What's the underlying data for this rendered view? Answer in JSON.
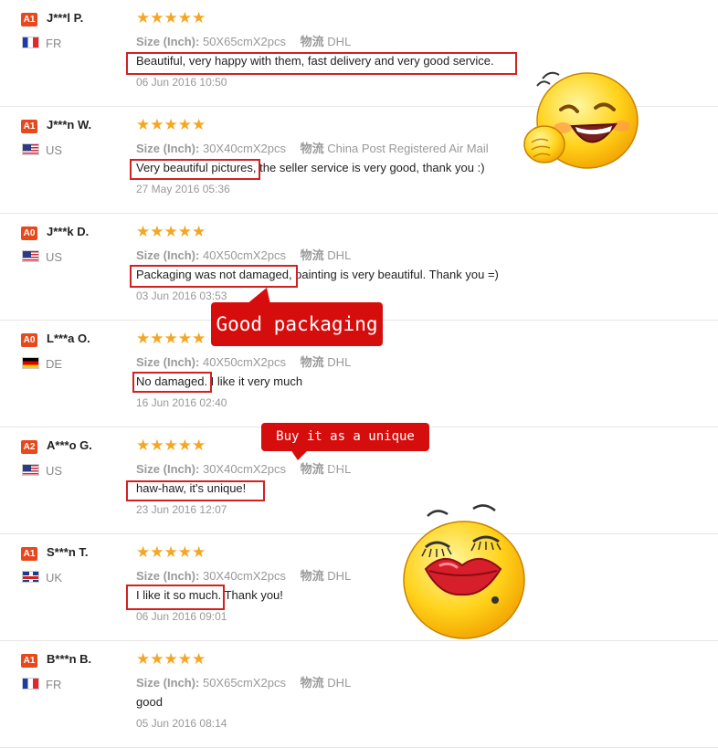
{
  "reviews": [
    {
      "badge": "A1",
      "name": "J***l P.",
      "flag": "fr",
      "country": "FR",
      "stars": "★★★★★",
      "size_label": "Size (Inch):",
      "size": "50X65cmX2pcs",
      "ship_label": "物流",
      "ship": "DHL",
      "comment": "Beautiful, very happy with them, fast delivery and very good service.",
      "date": "06 Jun 2016 10:50"
    },
    {
      "badge": "A1",
      "name": "J***n W.",
      "flag": "us",
      "country": "US",
      "stars": "★★★★★",
      "size_label": "Size (Inch):",
      "size": "30X40cmX2pcs",
      "ship_label": "物流",
      "ship": "China Post Registered Air Mail",
      "comment": "Very beautiful pictures, the seller service is very good, thank you :)",
      "date": "27 May 2016 05:36"
    },
    {
      "badge": "A0",
      "name": "J***k D.",
      "flag": "us",
      "country": "US",
      "stars": "★★★★★",
      "size_label": "Size (Inch):",
      "size": "40X50cmX2pcs",
      "ship_label": "物流",
      "ship": "DHL",
      "comment": "Packaging was not damaged, painting is very beautiful. Thank you =)",
      "date": "03 Jun 2016 03:53"
    },
    {
      "badge": "A0",
      "name": "L***a O.",
      "flag": "de",
      "country": "DE",
      "stars": "★★★★★",
      "size_label": "Size (Inch):",
      "size": "40X50cmX2pcs",
      "ship_label": "物流",
      "ship": "DHL",
      "comment": "No damaged. I like it very much",
      "date": "16 Jun 2016 02:40"
    },
    {
      "badge": "A2",
      "name": "A***o G.",
      "flag": "us",
      "country": "US",
      "stars": "★★★★★",
      "size_label": "Size (Inch):",
      "size": "30X40cmX2pcs",
      "ship_label": "物流",
      "ship": "DHL",
      "comment": "haw-haw, it's unique!",
      "date": "23 Jun 2016 12:07"
    },
    {
      "badge": "A1",
      "name": "S***n T.",
      "flag": "uk",
      "country": "UK",
      "stars": "★★★★★",
      "size_label": "Size (Inch):",
      "size": "30X40cmX2pcs",
      "ship_label": "物流",
      "ship": "DHL",
      "comment": "I like it so much. Thank you!",
      "date": "06 Jun 2016 09:01"
    },
    {
      "badge": "A1",
      "name": "B***n B.",
      "flag": "fr",
      "country": "FR",
      "stars": "★★★★★",
      "size_label": "Size (Inch):",
      "size": "50X65cmX2pcs",
      "ship_label": "物流",
      "ship": "DHL",
      "comment": "good",
      "date": "05 Jun 2016 08:14"
    }
  ],
  "callouts": {
    "good_packaging": "Good packaging",
    "unique_gift": "Buy it as a unique gift"
  },
  "colors": {
    "accent": "#e8481c",
    "star": "#f5a623",
    "callout": "#d60d0d",
    "highlight": "#d42020"
  }
}
